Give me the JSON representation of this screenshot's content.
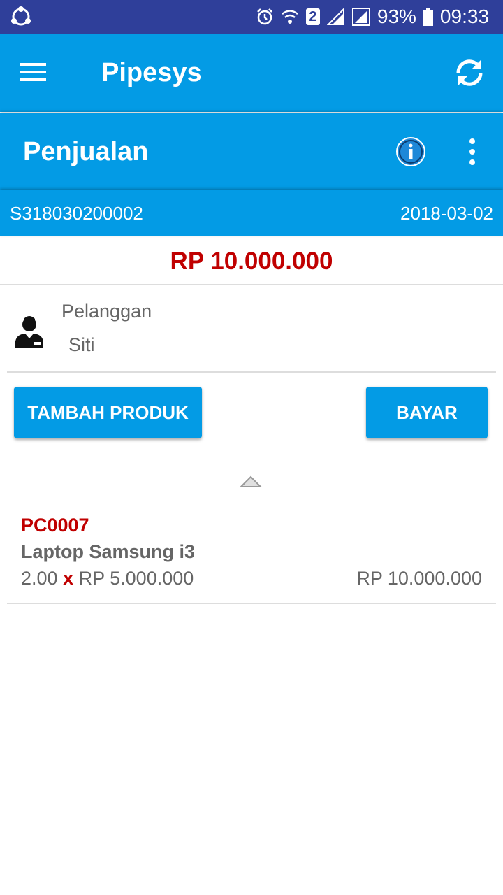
{
  "status_bar": {
    "sim_badge": "2",
    "battery": "93%",
    "time": "09:33",
    "icons": [
      "share-icon",
      "alarm-icon",
      "wifi-icon",
      "signal-icon",
      "signal-icon",
      "battery-icon"
    ]
  },
  "app_bar": {
    "title": "Pipesys",
    "icons": [
      "menu-icon",
      "sync-icon"
    ]
  },
  "page": {
    "title": "Penjualan",
    "icons": [
      "info-icon",
      "more-vert-icon"
    ]
  },
  "document": {
    "number": "S318030200002",
    "date": "2018-03-02"
  },
  "total": "RP 10.000.000",
  "customer": {
    "label": "Pelanggan",
    "name": "Siti",
    "icon": "person-icon"
  },
  "actions": {
    "add_product": "TAMBAH PRODUK",
    "pay": "BAYAR"
  },
  "items": [
    {
      "code": "PC0007",
      "name": "Laptop Samsung i3",
      "qty": "2.00",
      "times": "x",
      "price": "RP 5.000.000",
      "subtotal": "RP 10.000.000"
    }
  ],
  "colors": {
    "status_bar": "#2f3f9a",
    "primary": "#039be5",
    "accent_red": "#c00000",
    "text_gray": "#666666"
  }
}
